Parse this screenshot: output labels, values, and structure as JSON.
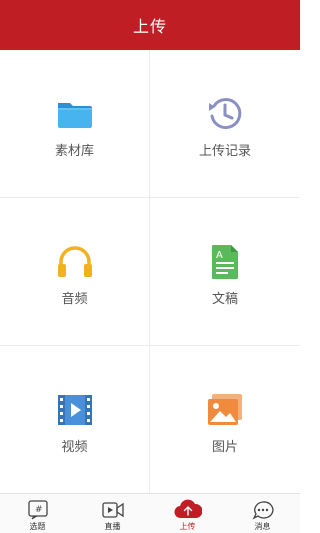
{
  "header": {
    "title": "上传"
  },
  "grid": {
    "items": [
      {
        "label": "素材库",
        "icon": "folder-icon"
      },
      {
        "label": "上传记录",
        "icon": "history-clock-icon"
      },
      {
        "label": "音频",
        "icon": "headphones-icon"
      },
      {
        "label": "文稿",
        "icon": "document-icon"
      },
      {
        "label": "视频",
        "icon": "film-icon"
      },
      {
        "label": "图片",
        "icon": "picture-icon"
      }
    ]
  },
  "tabbar": {
    "items": [
      {
        "label": "选题",
        "icon": "hash-icon",
        "active": false
      },
      {
        "label": "直播",
        "icon": "video-camera-icon",
        "active": false
      },
      {
        "label": "上传",
        "icon": "cloud-upload-icon",
        "active": true
      },
      {
        "label": "消息",
        "icon": "chat-bubble-icon",
        "active": false
      }
    ]
  },
  "colors": {
    "brand": "#bf1e24",
    "folder": "#3fa9e8",
    "history": "#8a8fc4",
    "headphones": "#f2b21f",
    "document": "#5cb85c",
    "film": "#4a8fd9",
    "picture": "#f08a3c"
  }
}
